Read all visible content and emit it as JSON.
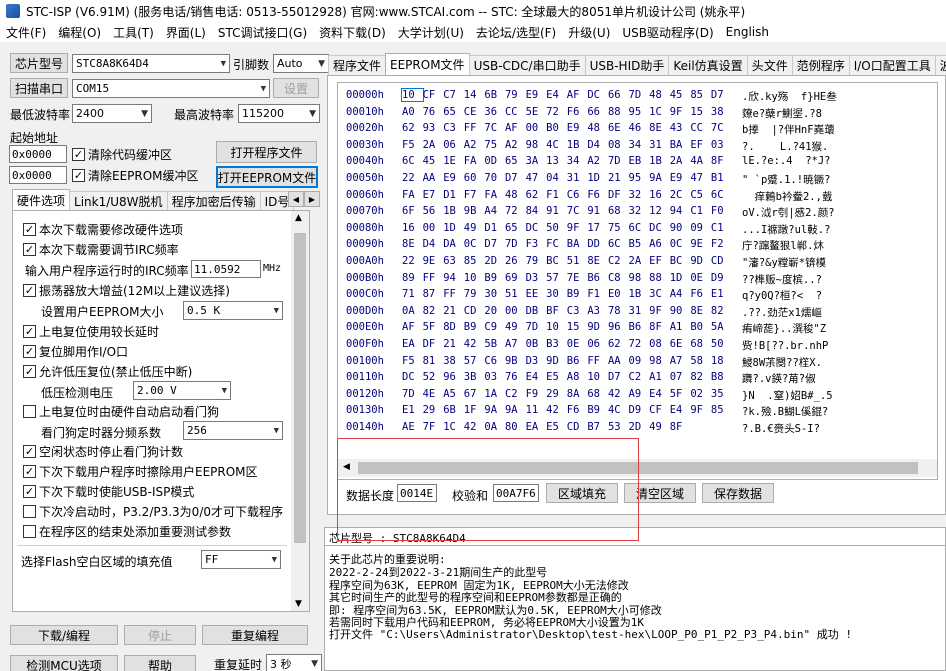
{
  "titlebar": {
    "text": "STC-ISP (V6.91M) (服务电话/销售电话: 0513-55012928) 官网:www.STCAI.com  -- STC: 全球最大的8051单片机设计公司 (姚永平)"
  },
  "menu": [
    "文件(F)",
    "编程(O)",
    "工具(T)",
    "界面(L)",
    "STC调试接口(G)",
    "资料下载(D)",
    "大学计划(U)",
    "去论坛/选型(F)",
    "升级(U)",
    "USB驱动程序(D)",
    "English"
  ],
  "left": {
    "chip_type_btn": "芯片型号",
    "chip_model": "STC8A8K64D4",
    "pins_label": "引脚数",
    "pins_value": "Auto",
    "scan_port_btn": "扫描串口",
    "com_port": "COM15",
    "settings_btn": "设置",
    "min_baud_label": "最低波特率",
    "min_baud": "2400",
    "max_baud_label": "最高波特率",
    "max_baud": "115200",
    "start_addr_label": "起始地址",
    "addr1": "0x0000",
    "clear_code_label": "清除代码缓冲区",
    "open_prog_btn": "打开程序文件",
    "addr2": "0x0000",
    "clear_eeprom_label": "清除EEPROM缓冲区",
    "open_eeprom_btn": "打开EEPROM文件",
    "tabs": [
      "硬件选项",
      "Link1/U8W脱机",
      "程序加密后传输",
      "ID号"
    ],
    "options": {
      "o1": "本次下载需要修改硬件选项",
      "o2": "本次下载需要调节IRC频率",
      "irc_label": "输入用户程序运行时的IRC频率",
      "irc_value": "11.0592",
      "irc_unit": "MHz",
      "o3": "振荡器放大增益(12M以上建议选择)",
      "eeprom_size_label": "设置用户EEPROM大小",
      "eeprom_size": "0.5 K",
      "o4": "上电复位使用较长延时",
      "o5": "复位脚用作I/O口",
      "o6": "允许低压复位(禁止低压中断)",
      "lvd_label": "低压检测电压",
      "lvd_value": "2.00 V",
      "o7": "上电复位时由硬件自动启动看门狗",
      "wdt_label": "看门狗定时器分频系数",
      "wdt_value": "256",
      "o8": "空闲状态时停止看门狗计数",
      "o9": "下次下载用户程序时擦除用户EEPROM区",
      "o10": "下次下载时使能USB-ISP模式",
      "o11": "下次冷启动时，P3.2/P3.3为0/0才可下载程序",
      "o12": "在程序区的结束处添加重要测试参数",
      "flash_fill_label": "选择Flash空白区域的填充值",
      "flash_fill_value": "FF"
    },
    "download_btn": "下载/编程",
    "stop_btn": "停止",
    "reprogram_btn": "重复编程",
    "detect_btn": "检测MCU选项",
    "help_btn": "帮助",
    "repeat_delay_label": "重复延时",
    "repeat_delay": "3 秒"
  },
  "right": {
    "tabs": [
      "程序文件",
      "EEPROM文件",
      "USB-CDC/串口助手",
      "USB-HID助手",
      "Keil仿真设置",
      "头文件",
      "范例程序",
      "I/O口配置工具",
      "波"
    ],
    "hex_rows": [
      {
        "addr": "00000h",
        "bytes": "10 CF C7 14 6B 79 E9 E4 AF DC 66 7D 48 45 85 D7",
        "ascii": ".欣.ky殇  f}HE叁"
      },
      {
        "addr": "00010h",
        "bytes": "A0 76 65 CE 36 CC 5E 72 F6 66 88 95 1C 9F 15 38",
        "ascii": "爒e?蘗r鰂埿.?8"
      },
      {
        "addr": "00020h",
        "bytes": "62 93 C3 FF 7C AF 00 B0 E9 48 6E 46 8E 43 CC 7C",
        "ascii": "b搼  |?伴HnF嶤蘾"
      },
      {
        "addr": "00030h",
        "bytes": "F5 2A 06 A2 75 A2 98 4C 1B D4 08 34 31 BA EF 03",
        "ascii": "?.    L.?41猴."
      },
      {
        "addr": "00040h",
        "bytes": "6C 45 1E FA 0D 65 3A 13 34 A2 7D EB 1B 2A 4A 8F",
        "ascii": "lE.?e:.4  ?*J?"
      },
      {
        "addr": "00050h",
        "bytes": "22 AA E9 60 70 D7 47 04 31 1D 21 95 9A E9 47 B1",
        "ascii": "\" `p蹙.1.!暁镢?"
      },
      {
        "addr": "00060h",
        "bytes": "FA E7 D1 F7 FA 48 62 F1 C6 F6 DF 32 16 2C C5 6C",
        "ascii": "  痒鶫b衿鲞2.,臷"
      },
      {
        "addr": "00070h",
        "bytes": "6F 56 1B 9B A4 72 84 91 7C 91 68 32 12 94 C1 F0",
        "ascii": "oV.泧r刳|慼2.颜?"
      },
      {
        "addr": "00080h",
        "bytes": "16 00 1D 49 D1 65 DC 50 9F 17 75 6C DC 90 09 C1",
        "ascii": "...I褯蹾?ul軙.?"
      },
      {
        "addr": "00090h",
        "bytes": "8E D4 DA 0C D7 7D F3 FC BA DD 6C B5 A6 0C 9E F2",
        "ascii": "庁?蹿鳌狠l郸.炑"
      },
      {
        "addr": "000A0h",
        "bytes": "22 9E 63 85 2D 26 79 BC 51 8E C2 2A EF BC 9D CD",
        "ascii": "\"瀋?&y糛嶄*锛橂"
      },
      {
        "addr": "000B0h",
        "bytes": "89 FF 94 10 B9 69 D3 57 7E B6 C8 98 88 1D 0E D9",
        "ascii": "??榫贩~度槟..?"
      },
      {
        "addr": "000C0h",
        "bytes": "71 87 FF 79 30 51 EE 30 B9 F1 E0 1B 3C A4 F6 E1",
        "ascii": "q?y0Q?桓?<  ?"
      },
      {
        "addr": "000D0h",
        "bytes": "0A 82 21 CD 20 00 DB BF C3 A3 78 31 9F 90 8E 82",
        "ascii": ".??.劲茫x1燸嶇"
      },
      {
        "addr": "000E0h",
        "bytes": "AF 5F 8D B9 C9 49 7D 10 15 9D 96 B6 8F A1 B0 5A",
        "ascii": "痏崹蒊}..潠稄\"Z"
      },
      {
        "addr": "000F0h",
        "bytes": "EA DF 21 42 5B A7 0B B3 0E 06 62 72 08 6E 68 50",
        "ascii": "赀!B[??.br.nhP"
      },
      {
        "addr": "00100h",
        "bytes": "F5 81 38 57 C6 9B D3 9D B6 FF AA 09 98 A7 58 18",
        "ascii": "鮼8W茮閿??樦X."
      },
      {
        "addr": "00110h",
        "bytes": "DC 52 96 3B 03 76 E4 E5 A8 10 D7 C2 A1 07 82 B8",
        "ascii": "躌?.v鍈?苚?俶"
      },
      {
        "addr": "00120h",
        "bytes": "7D 4E A5 67 1A C2 F9 29 8A 68 42 A9 E4 5F 02 35",
        "ascii": "}N  .窒)妱B#_.5"
      },
      {
        "addr": "00130h",
        "bytes": "E1 29 6B 1F 9A 9A 11 42 F6 B9 4C D9 CF E4 9F 85",
        "ascii": "?k.殮.B鰗L傒錕?"
      },
      {
        "addr": "00140h",
        "bytes": "AE 7F 1C 42 0A 80 EA E5 CD B7 53 2D 49 8F",
        "ascii": "?.B.€赍头S-I?"
      }
    ],
    "data_len_label": "数据长度",
    "data_len": "0014E",
    "checksum_label": "校验和",
    "checksum": "00A7F6",
    "fill_btn": "区域填充",
    "clear_btn": "清空区域",
    "save_btn": "保存数据",
    "chip_label": "芯片型号 : STC8A8K64D4",
    "info_lines": [
      "关于此芯片的重要说明:",
      "   2022-2-24到2022-3-21期间生产的此型号",
      "   程序空间为63K, EEPROM 固定为1K, EEPROM大小无法修改",
      "   其它时间生产的此型号的程序空间和EEPROM参数都是正确的",
      "   即: 程序空间为63.5K, EEPROM默认为0.5K, EEPROM大小可修改",
      "   若需同时下载用户代码和EEPROM, 务必将EEPROM大小设置为1K",
      "打开文件 \"C:\\Users\\Administrator\\Desktop\\test-hex\\LOOP_P0_P1_P2_P3_P4.bin\" 成功 !"
    ]
  }
}
